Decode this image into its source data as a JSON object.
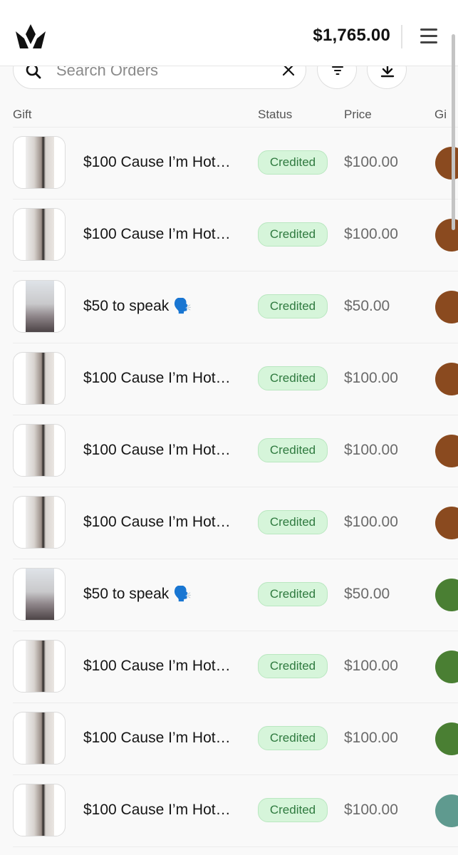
{
  "header": {
    "balance": "$1,765.00",
    "logo_icon": "crown-logo-icon",
    "menu_icon": "hamburger-menu-icon"
  },
  "search": {
    "placeholder": "Search Orders",
    "value": ""
  },
  "table": {
    "columns": {
      "gift": "Gift",
      "status": "Status",
      "price": "Price",
      "gifter": "Gi"
    },
    "rows": [
      {
        "title": "$100 Cause I’m Hot…",
        "status": "Credited",
        "price": "$100.00",
        "avatar_color": "#8a4a1f",
        "thumb": "a"
      },
      {
        "title": "$100 Cause I’m Hot…",
        "status": "Credited",
        "price": "$100.00",
        "avatar_color": "#8a4a1f",
        "thumb": "a"
      },
      {
        "title": "$50 to speak 🗣️",
        "status": "Credited",
        "price": "$50.00",
        "avatar_color": "#8a4a1f",
        "thumb": "b"
      },
      {
        "title": "$100 Cause I’m Hot…",
        "status": "Credited",
        "price": "$100.00",
        "avatar_color": "#8a4a1f",
        "thumb": "a"
      },
      {
        "title": "$100 Cause I’m Hot…",
        "status": "Credited",
        "price": "$100.00",
        "avatar_color": "#8a4a1f",
        "thumb": "a"
      },
      {
        "title": "$100 Cause I’m Hot…",
        "status": "Credited",
        "price": "$100.00",
        "avatar_color": "#8a4a1f",
        "thumb": "a"
      },
      {
        "title": "$50 to speak 🗣️",
        "status": "Credited",
        "price": "$50.00",
        "avatar_color": "#4a7f33",
        "thumb": "b"
      },
      {
        "title": "$100 Cause I’m Hot…",
        "status": "Credited",
        "price": "$100.00",
        "avatar_color": "#4a7f33",
        "thumb": "a"
      },
      {
        "title": "$100 Cause I’m Hot…",
        "status": "Credited",
        "price": "$100.00",
        "avatar_color": "#4a7f33",
        "thumb": "a"
      },
      {
        "title": "$100 Cause I’m Hot…",
        "status": "Credited",
        "price": "$100.00",
        "avatar_color": "#5f9a8f",
        "thumb": "a"
      }
    ]
  },
  "colors": {
    "badge_bg": "#d6f5da",
    "badge_text": "#2f7a3f"
  }
}
